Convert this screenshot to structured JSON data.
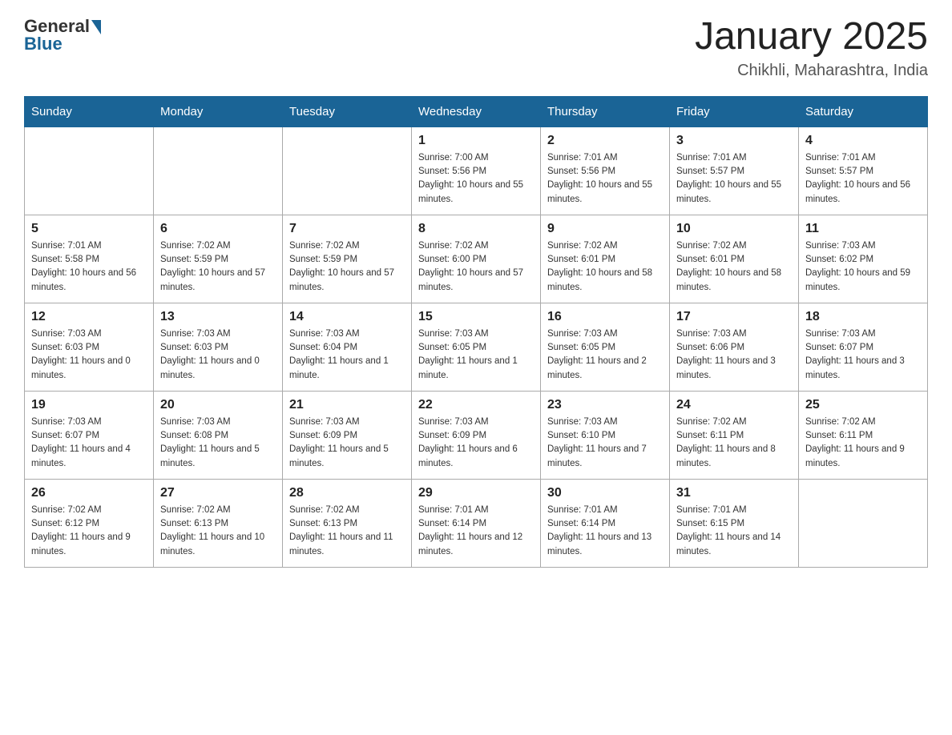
{
  "header": {
    "logo_general": "General",
    "logo_blue": "Blue",
    "title": "January 2025",
    "subtitle": "Chikhli, Maharashtra, India"
  },
  "days_of_week": [
    "Sunday",
    "Monday",
    "Tuesday",
    "Wednesday",
    "Thursday",
    "Friday",
    "Saturday"
  ],
  "weeks": [
    [
      {
        "day": "",
        "info": ""
      },
      {
        "day": "",
        "info": ""
      },
      {
        "day": "",
        "info": ""
      },
      {
        "day": "1",
        "info": "Sunrise: 7:00 AM\nSunset: 5:56 PM\nDaylight: 10 hours and 55 minutes."
      },
      {
        "day": "2",
        "info": "Sunrise: 7:01 AM\nSunset: 5:56 PM\nDaylight: 10 hours and 55 minutes."
      },
      {
        "day": "3",
        "info": "Sunrise: 7:01 AM\nSunset: 5:57 PM\nDaylight: 10 hours and 55 minutes."
      },
      {
        "day": "4",
        "info": "Sunrise: 7:01 AM\nSunset: 5:57 PM\nDaylight: 10 hours and 56 minutes."
      }
    ],
    [
      {
        "day": "5",
        "info": "Sunrise: 7:01 AM\nSunset: 5:58 PM\nDaylight: 10 hours and 56 minutes."
      },
      {
        "day": "6",
        "info": "Sunrise: 7:02 AM\nSunset: 5:59 PM\nDaylight: 10 hours and 57 minutes."
      },
      {
        "day": "7",
        "info": "Sunrise: 7:02 AM\nSunset: 5:59 PM\nDaylight: 10 hours and 57 minutes."
      },
      {
        "day": "8",
        "info": "Sunrise: 7:02 AM\nSunset: 6:00 PM\nDaylight: 10 hours and 57 minutes."
      },
      {
        "day": "9",
        "info": "Sunrise: 7:02 AM\nSunset: 6:01 PM\nDaylight: 10 hours and 58 minutes."
      },
      {
        "day": "10",
        "info": "Sunrise: 7:02 AM\nSunset: 6:01 PM\nDaylight: 10 hours and 58 minutes."
      },
      {
        "day": "11",
        "info": "Sunrise: 7:03 AM\nSunset: 6:02 PM\nDaylight: 10 hours and 59 minutes."
      }
    ],
    [
      {
        "day": "12",
        "info": "Sunrise: 7:03 AM\nSunset: 6:03 PM\nDaylight: 11 hours and 0 minutes."
      },
      {
        "day": "13",
        "info": "Sunrise: 7:03 AM\nSunset: 6:03 PM\nDaylight: 11 hours and 0 minutes."
      },
      {
        "day": "14",
        "info": "Sunrise: 7:03 AM\nSunset: 6:04 PM\nDaylight: 11 hours and 1 minute."
      },
      {
        "day": "15",
        "info": "Sunrise: 7:03 AM\nSunset: 6:05 PM\nDaylight: 11 hours and 1 minute."
      },
      {
        "day": "16",
        "info": "Sunrise: 7:03 AM\nSunset: 6:05 PM\nDaylight: 11 hours and 2 minutes."
      },
      {
        "day": "17",
        "info": "Sunrise: 7:03 AM\nSunset: 6:06 PM\nDaylight: 11 hours and 3 minutes."
      },
      {
        "day": "18",
        "info": "Sunrise: 7:03 AM\nSunset: 6:07 PM\nDaylight: 11 hours and 3 minutes."
      }
    ],
    [
      {
        "day": "19",
        "info": "Sunrise: 7:03 AM\nSunset: 6:07 PM\nDaylight: 11 hours and 4 minutes."
      },
      {
        "day": "20",
        "info": "Sunrise: 7:03 AM\nSunset: 6:08 PM\nDaylight: 11 hours and 5 minutes."
      },
      {
        "day": "21",
        "info": "Sunrise: 7:03 AM\nSunset: 6:09 PM\nDaylight: 11 hours and 5 minutes."
      },
      {
        "day": "22",
        "info": "Sunrise: 7:03 AM\nSunset: 6:09 PM\nDaylight: 11 hours and 6 minutes."
      },
      {
        "day": "23",
        "info": "Sunrise: 7:03 AM\nSunset: 6:10 PM\nDaylight: 11 hours and 7 minutes."
      },
      {
        "day": "24",
        "info": "Sunrise: 7:02 AM\nSunset: 6:11 PM\nDaylight: 11 hours and 8 minutes."
      },
      {
        "day": "25",
        "info": "Sunrise: 7:02 AM\nSunset: 6:11 PM\nDaylight: 11 hours and 9 minutes."
      }
    ],
    [
      {
        "day": "26",
        "info": "Sunrise: 7:02 AM\nSunset: 6:12 PM\nDaylight: 11 hours and 9 minutes."
      },
      {
        "day": "27",
        "info": "Sunrise: 7:02 AM\nSunset: 6:13 PM\nDaylight: 11 hours and 10 minutes."
      },
      {
        "day": "28",
        "info": "Sunrise: 7:02 AM\nSunset: 6:13 PM\nDaylight: 11 hours and 11 minutes."
      },
      {
        "day": "29",
        "info": "Sunrise: 7:01 AM\nSunset: 6:14 PM\nDaylight: 11 hours and 12 minutes."
      },
      {
        "day": "30",
        "info": "Sunrise: 7:01 AM\nSunset: 6:14 PM\nDaylight: 11 hours and 13 minutes."
      },
      {
        "day": "31",
        "info": "Sunrise: 7:01 AM\nSunset: 6:15 PM\nDaylight: 11 hours and 14 minutes."
      },
      {
        "day": "",
        "info": ""
      }
    ]
  ]
}
